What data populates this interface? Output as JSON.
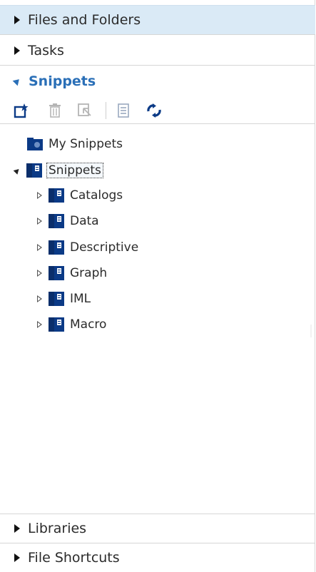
{
  "sections": {
    "files_and_folders": "Files and Folders",
    "tasks": "Tasks",
    "snippets": "Snippets",
    "libraries": "Libraries",
    "file_shortcuts": "File Shortcuts"
  },
  "toolbar": {
    "buttons": [
      "new-snippet-icon",
      "delete-icon",
      "open-icon",
      "properties-icon",
      "refresh-icon"
    ]
  },
  "tree": {
    "my_snippets": "My Snippets",
    "root": "Snippets",
    "children": [
      "Catalogs",
      "Data",
      "Descriptive",
      "Graph",
      "IML",
      "Macro"
    ]
  },
  "colors": {
    "header_selected_bg": "#daeaf6",
    "accent_blue": "#2a6fb7",
    "folder_navy": "#0b3a86"
  }
}
